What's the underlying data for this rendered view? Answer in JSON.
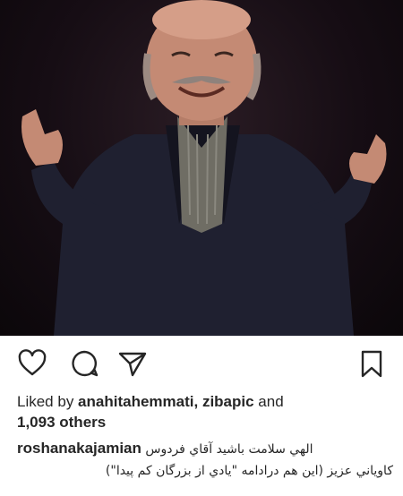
{
  "post": {
    "image_alt": "Smiling man in a dark suit with open arms on a dark stage",
    "icons": {
      "like": "heart-icon",
      "comment": "comment-icon",
      "share": "paper-plane-icon",
      "save": "bookmark-icon"
    },
    "likes": {
      "prefix": "Liked by ",
      "user1": "anahitahemmati",
      "separator": ", ",
      "user2": "zibapic",
      "and": " and",
      "others": "1,093 others"
    },
    "caption": {
      "username": "roshanakajamian",
      "text_line1": "الهي سلامت باشيد آقاي فردوس",
      "text_line2": "كاوياني عزيز (اين هم درادامه \"يادي از بزرگان كم پيدا\")"
    }
  }
}
